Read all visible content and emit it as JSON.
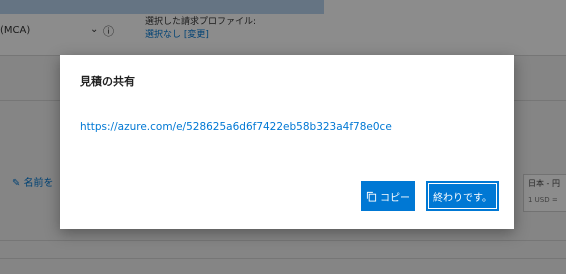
{
  "background": {
    "select_value": "(MCA)",
    "profile_label": "選択した請求プロファイル:",
    "profile_value": "選択なし [変更]",
    "rename_label": "名前を",
    "currency_label": "日本 - 円",
    "currency_sub": "1 USD ="
  },
  "dialog": {
    "title": "見積の共有",
    "link": "https://azure.com/e/528625a6d6f7422eb58b323a4f78e0ce",
    "copy_label": "コピー",
    "done_label": "終わりです。"
  }
}
